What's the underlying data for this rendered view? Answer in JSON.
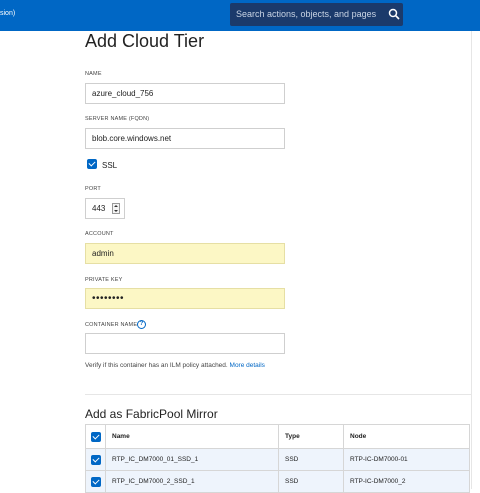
{
  "topbar": {
    "left_text": "sion)",
    "search_placeholder": "Search actions, objects, and pages"
  },
  "page_title": "Add Cloud Tier",
  "form": {
    "name_label": "NAME",
    "name_value": "azure_cloud_756",
    "server_label": "SERVER NAME (FQDN)",
    "server_value": "blob.core.windows.net",
    "ssl_label": "SSL",
    "ssl_checked": true,
    "port_label": "PORT",
    "port_value": "443",
    "account_label": "ACCOUNT",
    "account_value": "admin",
    "private_key_label": "PRIVATE KEY",
    "private_key_value": "••••••••",
    "container_label": "CONTAINER NAME",
    "container_value": "",
    "help_glyph": "?",
    "verify_text": "Verify if this container has an ILM policy attached.",
    "more_details": "More details"
  },
  "mirror": {
    "title": "Add as FabricPool Mirror",
    "columns": [
      "Name",
      "Type",
      "Node"
    ],
    "rows": [
      {
        "name": "RTP_IC_DM7000_01_SSD_1",
        "type": "SSD",
        "node": "RTP-IC-DM7000-01",
        "checked": true
      },
      {
        "name": "RTP_IC_DM7000_2_SSD_1",
        "type": "SSD",
        "node": "RTP-IC-DM7000_2",
        "checked": true
      }
    ]
  },
  "colors": {
    "brand_blue": "#0067c5",
    "autofill_yellow": "#fcf7c5"
  }
}
